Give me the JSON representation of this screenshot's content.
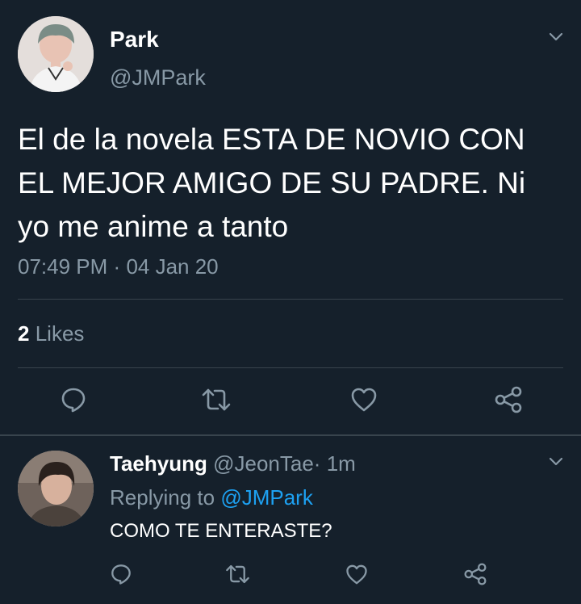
{
  "main_tweet": {
    "display_name": "Park",
    "handle": "@JMPark",
    "text_lines": [
      "El de la novela ESTA DE NOVIO CON",
      "EL MEJOR AMIGO DE SU PADRE. Ni",
      "yo me anime a tanto"
    ],
    "time": "07:49 PM",
    "separator": "·",
    "date": "04 Jan 20",
    "likes_count": "2",
    "likes_label": "Likes"
  },
  "reply": {
    "display_name": "Taehyung",
    "handle": "@JeonTae",
    "separator": "·",
    "age": "1m",
    "replying_to_label": "Replying to",
    "replying_to_handle": "@JMPark",
    "text": "COMO TE ENTERASTE?"
  },
  "icons": {
    "reply": "reply-icon",
    "retweet": "retweet-icon",
    "like": "heart-icon",
    "share": "share-icon",
    "menu": "chevron-down-icon"
  },
  "colors": {
    "background": "#15202b",
    "text": "#ffffff",
    "muted": "#8899a6",
    "accent": "#1da1f2",
    "divider": "#38444d"
  }
}
